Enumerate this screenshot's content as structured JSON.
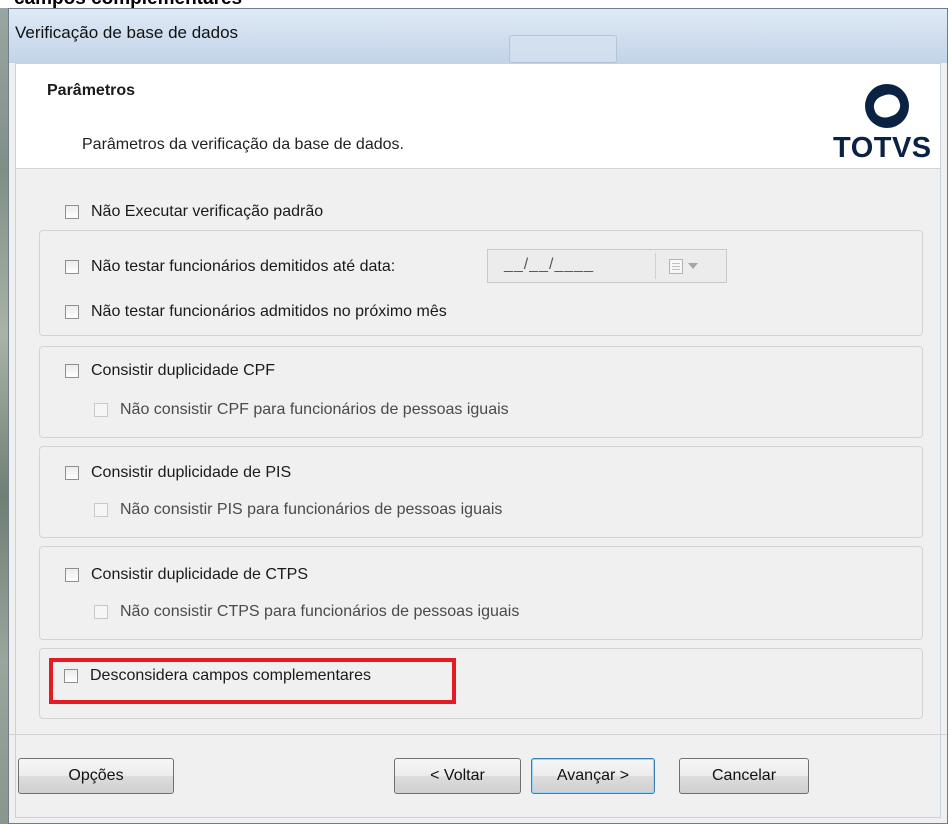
{
  "background": {
    "caption": "campos complementares"
  },
  "window": {
    "title": "Verificação de base de dados"
  },
  "header": {
    "title": "Parâmetros",
    "description": "Parâmetros da verificação da base de dados.",
    "logo_text": "TOTVS",
    "logo_color": "#0b2343"
  },
  "options": {
    "nao_executar_verificacao_padrao": {
      "label": "Não Executar verificação padrão",
      "checked": false
    },
    "nao_testar_demitidos": {
      "label": "Não testar funcionários demitidos até data:",
      "checked": false
    },
    "data_demitidos": {
      "value": "__/__/____",
      "enabled": false
    },
    "nao_testar_admitidos": {
      "label": "Não testar funcionários admitidos no próximo mês",
      "checked": false
    },
    "consistir_cpf": {
      "label": "Consistir duplicidade CPF",
      "checked": false
    },
    "nao_consistir_cpf": {
      "label": "Não consistir CPF para funcionários de pessoas iguais",
      "checked": false,
      "enabled": false
    },
    "consistir_pis": {
      "label": "Consistir duplicidade de PIS",
      "checked": false
    },
    "nao_consistir_pis": {
      "label": "Não consistir PIS para funcionários de pessoas iguais",
      "checked": false,
      "enabled": false
    },
    "consistir_ctps": {
      "label": "Consistir duplicidade de CTPS",
      "checked": false
    },
    "nao_consistir_ctps": {
      "label": "Não consistir CTPS para funcionários de pessoas iguais",
      "checked": false,
      "enabled": false
    },
    "desconsidera_campos": {
      "label": "Desconsidera campos complementares",
      "checked": false,
      "highlighted": true
    }
  },
  "highlight_color": "#e41b23",
  "footer": {
    "opcoes": "Opções",
    "voltar": "< Voltar",
    "avancar": "Avançar >",
    "cancelar": "Cancelar"
  }
}
